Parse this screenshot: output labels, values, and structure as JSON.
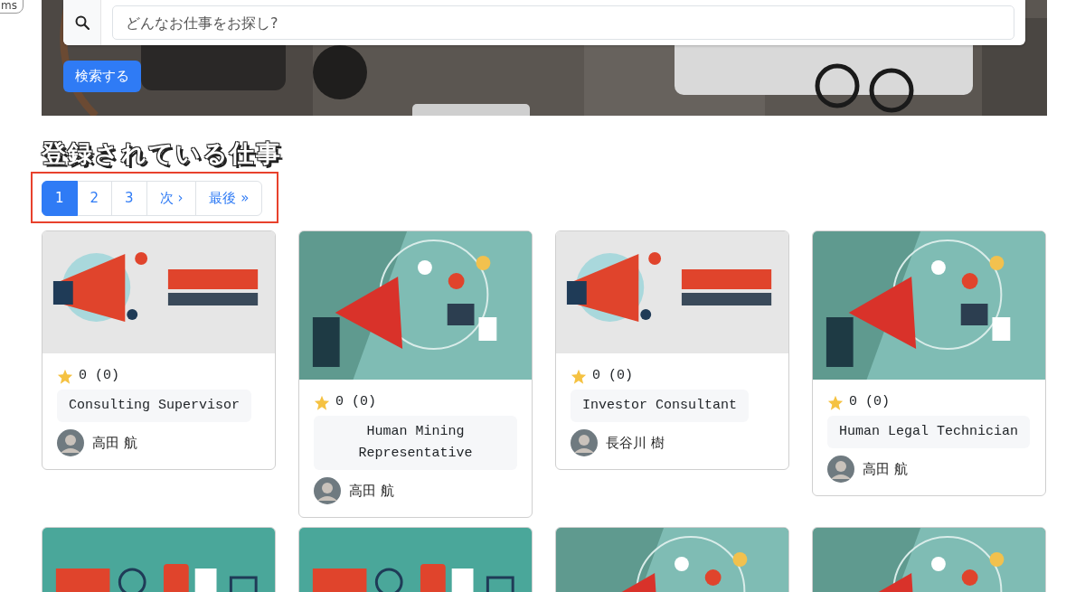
{
  "corner_tag": "ms",
  "search": {
    "placeholder": "どんなお仕事をお探し?",
    "button": "検索する"
  },
  "section_title": "登録されている仕事",
  "pagination": [
    {
      "label": "1",
      "selected": true
    },
    {
      "label": "2",
      "selected": false
    },
    {
      "label": "3",
      "selected": false
    },
    {
      "label": "次 ›",
      "selected": false
    },
    {
      "label": "最後 »",
      "selected": false
    }
  ],
  "jobs": [
    {
      "kind": "job",
      "rating": "0 (0)",
      "title": "Consulting Supervisor",
      "author": "高田 航"
    },
    {
      "kind": "job",
      "rating": "0 (0)",
      "title": "Human Mining Representative",
      "author": "高田 航"
    },
    {
      "kind": "job",
      "rating": "0 (0)",
      "title": "Investor Consultant",
      "author": "長谷川 樹"
    },
    {
      "kind": "job",
      "rating": "0 (0)",
      "title": "Human Legal Technician",
      "author": "高田 航"
    },
    {
      "kind": "picture"
    },
    {
      "kind": "picture"
    },
    {
      "kind": "picture"
    },
    {
      "kind": "picture"
    }
  ]
}
